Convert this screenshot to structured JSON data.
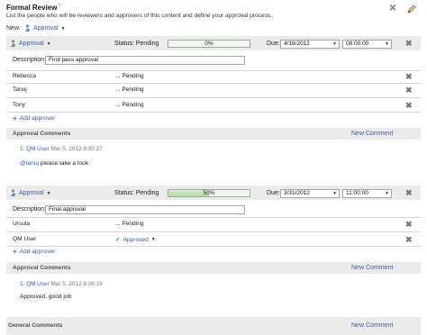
{
  "header": {
    "title": "Formal Review",
    "help": "?",
    "subtitle": "List the people who will be reviewers and approvers of this content and define your approval process.",
    "new_label": "New:",
    "new_type": "Approval"
  },
  "approvals": [
    {
      "type": "Approval",
      "status": "Status: Pending",
      "progress_label": "0%",
      "progress_value": 0,
      "due_label": "Due:",
      "due_date": "4/18/2012",
      "due_time": "08:00:00",
      "description_label": "Description:",
      "description": "First pass approval",
      "approvers": [
        {
          "name": "Rebecca",
          "status": "... Pending"
        },
        {
          "name": "Tanuj",
          "status": "... Pending"
        },
        {
          "name": "Tony",
          "status": "... Pending"
        }
      ],
      "add_approver": "Add approver",
      "comments_title": "Approval Comments",
      "new_comment": "New Comment",
      "comment": {
        "author": "1: QM User",
        "date": "Mar 5, 2012 8:35:27",
        "mention": "@tanuj",
        "text": " please take a look"
      }
    },
    {
      "type": "Approval",
      "status": "Status: Pending",
      "progress_label": "50%",
      "progress_value": 50,
      "due_label": "Due:",
      "due_date": "3/31/2012",
      "due_time": "11:00:00",
      "description_label": "Description:",
      "description": "Final approval",
      "approvers": [
        {
          "name": "Ursula",
          "status": "... Pending"
        },
        {
          "name": "QM User",
          "status": "Approved"
        }
      ],
      "add_approver": "Add approver",
      "comments_title": "Approval Comments",
      "new_comment": "New Comment",
      "comment": {
        "author": "1: QM User",
        "date": "Mar 5, 2012 8:38:19",
        "text": "Approved, good job"
      }
    }
  ],
  "general": {
    "title": "General Comments",
    "new_comment": "New Comment"
  },
  "colors": {
    "link": "#3560a8",
    "band": "#ebebeb",
    "progress_fill": "#b6dba9",
    "check": "#3b9b2e"
  }
}
